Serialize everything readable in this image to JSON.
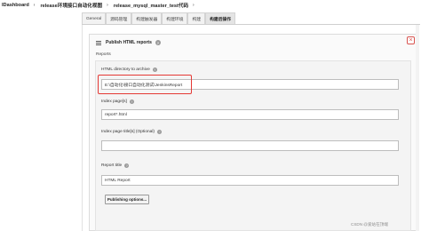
{
  "breadcrumb": {
    "items": [
      "lDashboard",
      "release环境接口自动化视图",
      "release_mysql_master_test代码"
    ]
  },
  "tabs": [
    "General",
    "源码管理",
    "构建触发器",
    "构建环境",
    "构建",
    "构建后操作"
  ],
  "active_tab": "构建后操作",
  "panel": {
    "title": "Publish HTML reports",
    "close_symbol": "×",
    "section_label": "Reports"
  },
  "fields": {
    "dir": {
      "label": "HTML directory to archive",
      "value": "E:\\自动化\\接口自动化测试\\JenkinsReport"
    },
    "index": {
      "label": "Index page[s]",
      "value": "report*.html"
    },
    "index_titles": {
      "label": "Index page title[s] (Optional)",
      "value": ""
    },
    "report_title": {
      "label": "Report title",
      "value": "HTML Report"
    }
  },
  "publishing_button": "Publishing options...",
  "help_symbol": "?",
  "watermark": "CSDN @爱站在顶端",
  "colors": {
    "highlight": "#e53935",
    "close": "#d9534f"
  }
}
